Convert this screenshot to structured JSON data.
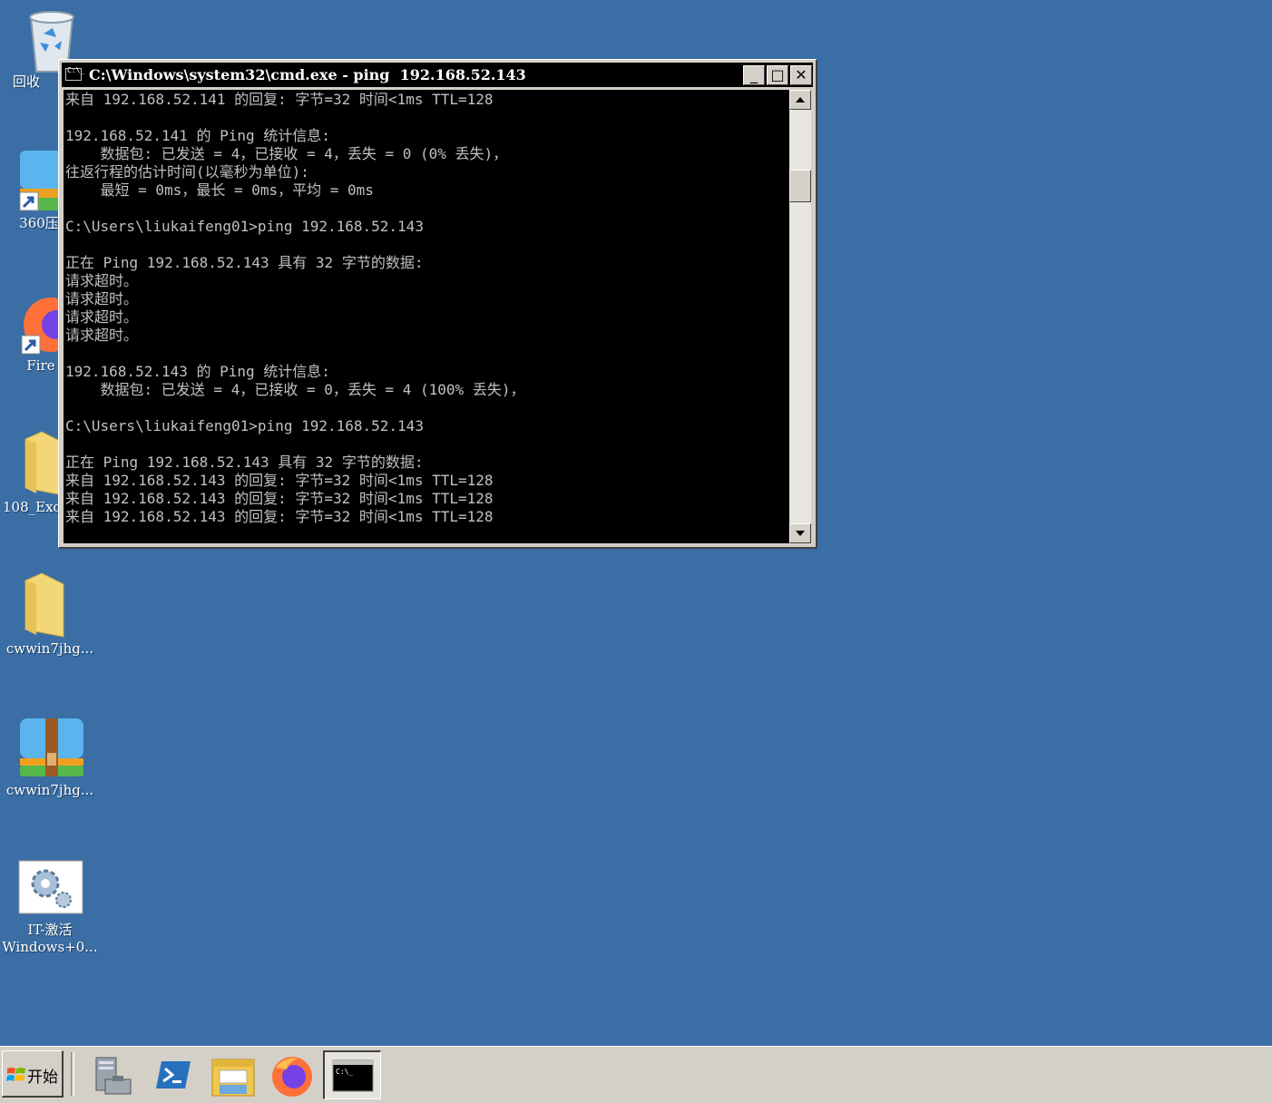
{
  "desktop": {
    "icons": [
      {
        "label": "回收",
        "icon": "recycle-bin-icon"
      },
      {
        "label": "360压",
        "icon": "360zip-shortcut-icon"
      },
      {
        "label": "Fire",
        "icon": "firefox-shortcut-icon"
      },
      {
        "label": "108_Exc",
        "icon": "folder-icon"
      },
      {
        "label": "cwwin7jhg...",
        "icon": "folder-icon"
      },
      {
        "label": "cwwin7jhg...",
        "icon": "360zip-archive-icon"
      },
      {
        "label": "IT-激活\nWindows+0...",
        "icon": "gear-config-icon"
      }
    ]
  },
  "cmd_window": {
    "title": "C:\\Windows\\system32\\cmd.exe - ping  192.168.52.143",
    "console_lines": [
      "来自 192.168.52.141 的回复: 字节=32 时间<1ms TTL=128",
      "",
      "192.168.52.141 的 Ping 统计信息:",
      "    数据包: 已发送 = 4，已接收 = 4，丢失 = 0 (0% 丢失)，",
      "往返行程的估计时间(以毫秒为单位):",
      "    最短 = 0ms，最长 = 0ms，平均 = 0ms",
      "",
      "C:\\Users\\liukaifeng01>ping 192.168.52.143",
      "",
      "正在 Ping 192.168.52.143 具有 32 字节的数据:",
      "请求超时。",
      "请求超时。",
      "请求超时。",
      "请求超时。",
      "",
      "192.168.52.143 的 Ping 统计信息:",
      "    数据包: 已发送 = 4，已接收 = 0，丢失 = 4 (100% 丢失)，",
      "",
      "C:\\Users\\liukaifeng01>ping 192.168.52.143",
      "",
      "正在 Ping 192.168.52.143 具有 32 字节的数据:",
      "来自 192.168.52.143 的回复: 字节=32 时间<1ms TTL=128",
      "来自 192.168.52.143 的回复: 字节=32 时间<1ms TTL=128",
      "来自 192.168.52.143 的回复: 字节=32 时间<1ms TTL=128"
    ],
    "buttons": {
      "minimize": "_",
      "maximize": "□",
      "close": "✕"
    }
  },
  "taskbar": {
    "start_label": "开始",
    "items": [
      "server-manager-icon",
      "powershell-icon",
      "explorer-icon",
      "firefox-icon",
      "cmd-icon"
    ]
  },
  "colors": {
    "desktop": "#3a6ea5",
    "taskbar": "#d4d0c8",
    "console_text": "#c0c0c0"
  }
}
